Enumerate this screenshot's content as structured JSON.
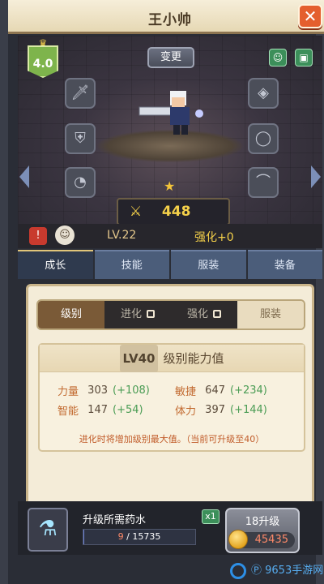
{
  "window": {
    "title": "王小帅",
    "close_glyph": "✕"
  },
  "hero": {
    "level_badge": "4.0",
    "change_button": "变更",
    "power": "448",
    "level_text": "LV.22",
    "enhance_text": "强化+0",
    "equipment_slots": [
      {
        "name": "weapon-slot",
        "icon": "sword"
      },
      {
        "name": "armor-slot",
        "icon": "armor"
      },
      {
        "name": "helmet-slot",
        "icon": "helmet"
      },
      {
        "name": "necklace-slot",
        "icon": "necklace"
      },
      {
        "name": "ring-slot",
        "icon": "ring"
      },
      {
        "name": "cap-slot",
        "icon": "cap"
      }
    ]
  },
  "tabs": [
    {
      "label": "成长",
      "active": true
    },
    {
      "label": "技能",
      "active": false
    },
    {
      "label": "服装",
      "active": false
    },
    {
      "label": "装备",
      "active": false
    }
  ],
  "subtabs": [
    {
      "label": "级别",
      "state": "active"
    },
    {
      "label": "进化",
      "state": "locked"
    },
    {
      "label": "强化",
      "state": "locked"
    },
    {
      "label": "服装",
      "state": "normal"
    }
  ],
  "stats_card": {
    "level_tag": "LV40",
    "heading": "级别能力值",
    "rows": [
      [
        {
          "label": "力量",
          "value": "303",
          "bonus": "(+108)"
        },
        {
          "label": "敏捷",
          "value": "647",
          "bonus": "(+234)"
        }
      ],
      [
        {
          "label": "智能",
          "value": "147",
          "bonus": "(+54)"
        },
        {
          "label": "体力",
          "value": "397",
          "bonus": "(+144)"
        }
      ]
    ],
    "note": "进化时将增加级别最大值。（当前可升级至40）"
  },
  "footer": {
    "need_label": "升级所需药水",
    "progress_current": "9",
    "progress_separator": " / ",
    "progress_total": "15735",
    "progress_ratio": 0.0006,
    "multiplier": "x1",
    "upgrade_label": "18升级",
    "cost": "45435"
  },
  "colors": {
    "accent_gold": "#f4d04a",
    "panel_bg": "#f4ecd8",
    "tab_active": "#2f3a4e",
    "tab_inactive": "#4b5d7a"
  },
  "watermark": {
    "text": "Ⓟ 9653手游网"
  }
}
